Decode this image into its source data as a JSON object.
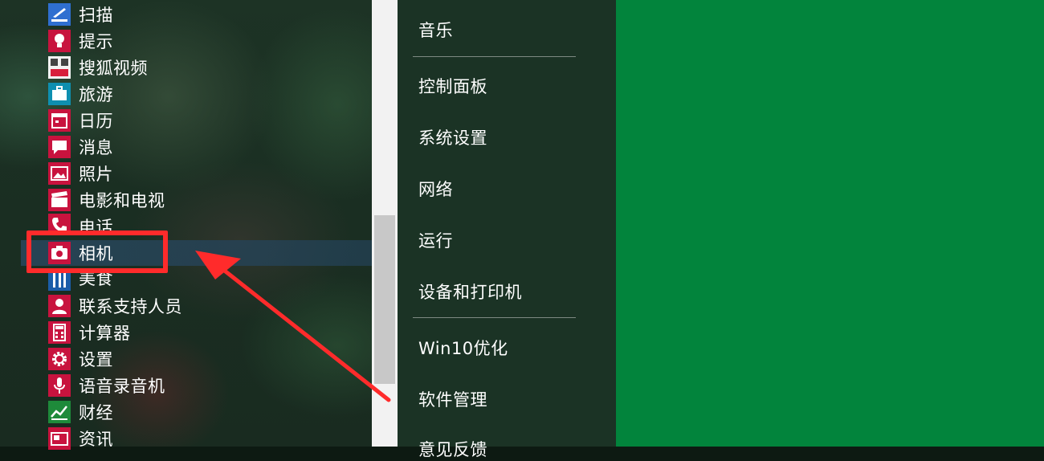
{
  "app_list": {
    "items": [
      {
        "label": "扫描",
        "icon": "scan-icon",
        "color": "#2f6fd0"
      },
      {
        "label": "提示",
        "icon": "lightbulb-icon",
        "color": "#c8133e"
      },
      {
        "label": "搜狐视频",
        "icon": "sohu-video-icon",
        "color": "#ffffff"
      },
      {
        "label": "旅游",
        "icon": "suitcase-icon",
        "color": "#0e8fb0"
      },
      {
        "label": "日历",
        "icon": "calendar-icon",
        "color": "#c8133e"
      },
      {
        "label": "消息",
        "icon": "message-icon",
        "color": "#c8133e"
      },
      {
        "label": "照片",
        "icon": "photo-icon",
        "color": "#c8133e"
      },
      {
        "label": "电影和电视",
        "icon": "clapperboard-icon",
        "color": "#c8133e"
      },
      {
        "label": "电话",
        "icon": "phone-icon",
        "color": "#c8133e"
      },
      {
        "label": "相机",
        "icon": "camera-icon",
        "color": "#c8133e"
      },
      {
        "label": "美食",
        "icon": "food-icon",
        "color": "#1b5da8"
      },
      {
        "label": "联系支持人员",
        "icon": "support-person-icon",
        "color": "#c8133e"
      },
      {
        "label": "计算器",
        "icon": "calculator-icon",
        "color": "#c8133e"
      },
      {
        "label": "设置",
        "icon": "gear-icon",
        "color": "#c8133e"
      },
      {
        "label": "语音录音机",
        "icon": "microphone-icon",
        "color": "#c8133e"
      },
      {
        "label": "财经",
        "icon": "finance-chart-icon",
        "color": "#1e8a3a"
      },
      {
        "label": "资讯",
        "icon": "news-icon",
        "color": "#c8133e"
      }
    ]
  },
  "quick_menu": {
    "items": [
      {
        "label": "音乐"
      },
      {
        "label": "控制面板"
      },
      {
        "label": "系统设置"
      },
      {
        "label": "网络"
      },
      {
        "label": "运行"
      },
      {
        "label": "设备和打印机"
      },
      {
        "label": "Win10优化"
      },
      {
        "label": "软件管理"
      },
      {
        "label": "意见反馈"
      }
    ]
  },
  "colors": {
    "highlight": "#ff2b2b",
    "tile_green": "#02843c",
    "icon_red": "#c8133e"
  }
}
